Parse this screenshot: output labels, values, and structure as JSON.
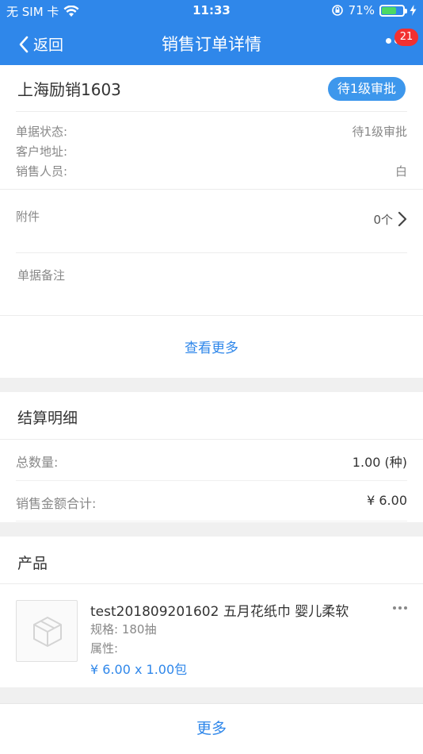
{
  "status_bar": {
    "carrier": "无 SIM 卡",
    "time": "11:33",
    "battery_percent": "71%",
    "battery_level": 0.71
  },
  "nav": {
    "back_label": "返回",
    "title": "销售订单详情",
    "badge_count": "21"
  },
  "order": {
    "name": "上海励销1603",
    "status_tag": "待1级审批",
    "fields": [
      {
        "label": "单据状态:",
        "value": "待1级审批"
      },
      {
        "label": "客户地址:",
        "value": ""
      },
      {
        "label": "销售人员:",
        "value": "白"
      }
    ],
    "attachment_label": "附件",
    "attachment_count": "0个",
    "remark_label": "单据备注",
    "view_more": "查看更多"
  },
  "settlement": {
    "title": "结算明细",
    "rows": [
      {
        "label": "总数量:",
        "value": "1.00 (种)"
      },
      {
        "label": "销售金额合计:",
        "value": "¥ 6.00"
      }
    ]
  },
  "products": {
    "title": "产品",
    "items": [
      {
        "name": "test201809201602 五月花纸巾 婴儿柔软",
        "spec": "规格: 180抽",
        "attr": "属性:",
        "price": "¥ 6.00 x 1.00包"
      }
    ]
  },
  "footer": {
    "more_label": "更多"
  },
  "colors": {
    "brand_blue": "#2f87ea",
    "badge_red": "#f23030",
    "battery_green": "#4cd964"
  }
}
